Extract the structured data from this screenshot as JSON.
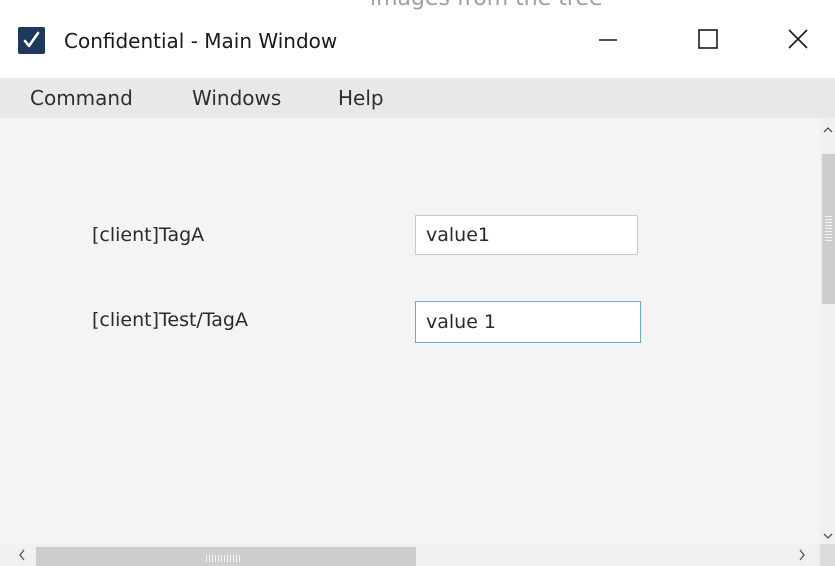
{
  "background": {
    "peek_text": "images from the tree"
  },
  "window": {
    "title": "Confidential - Main Window",
    "icon": "checkmark-app-icon",
    "controls": {
      "minimize_icon": "minimize-icon",
      "maximize_icon": "maximize-icon",
      "close_icon": "close-icon"
    }
  },
  "menubar": {
    "items": [
      {
        "label": "Command"
      },
      {
        "label": "Windows"
      },
      {
        "label": "Help"
      }
    ]
  },
  "form": {
    "fields": [
      {
        "label": "[client]TagA",
        "value": "value1"
      },
      {
        "label": "[client]Test/TagA",
        "value": "value 1"
      }
    ]
  },
  "colors": {
    "title_bar": "#ffffff",
    "menu_bar": "#e8e8e8",
    "content_bg": "#f4f4f4",
    "app_icon_bg": "#1d3a5c",
    "focused_input_border": "#6aa6d9"
  }
}
